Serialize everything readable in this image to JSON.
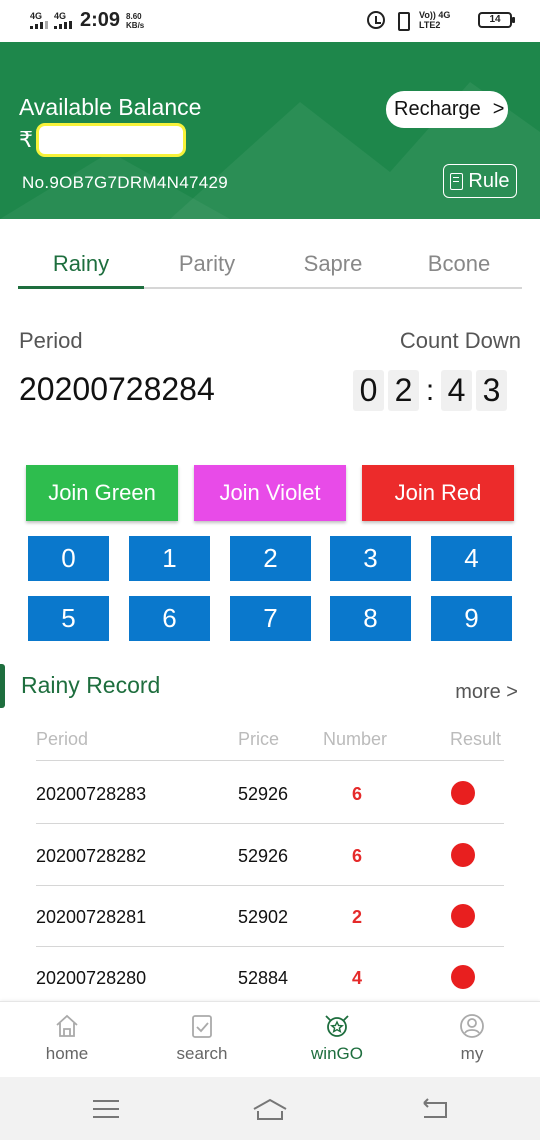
{
  "status_bar": {
    "signal1": "4G",
    "signal2": "4G",
    "time": "2:09",
    "speed_value": "8.60",
    "speed_unit": "KB/s",
    "network": "Vo)) 4G LTE2",
    "battery": "14"
  },
  "header": {
    "balance_label": "Available Balance",
    "currency_symbol": "₹",
    "account_number": "No.9OB7G7DRM4N47429",
    "recharge_label": "Recharge",
    "recharge_arrow": ">",
    "rule_label": "Rule"
  },
  "tabs": [
    {
      "label": "Rainy",
      "active": true
    },
    {
      "label": "Parity",
      "active": false
    },
    {
      "label": "Sapre",
      "active": false
    },
    {
      "label": "Bcone",
      "active": false
    }
  ],
  "period": {
    "label": "Period",
    "value": "20200728284"
  },
  "countdown": {
    "label": "Count Down",
    "digits": [
      "0",
      "2",
      "4",
      "3"
    ],
    "separator": ":"
  },
  "join_buttons": {
    "green": "Join Green",
    "violet": "Join Violet",
    "red": "Join Red"
  },
  "numbers": [
    "0",
    "1",
    "2",
    "3",
    "4",
    "5",
    "6",
    "7",
    "8",
    "9"
  ],
  "record": {
    "title": "Rainy Record",
    "more": "more >",
    "columns": [
      "Period",
      "Price",
      "Number",
      "Result"
    ],
    "rows": [
      {
        "period": "20200728283",
        "price": "52926",
        "number": "6",
        "result": "red"
      },
      {
        "period": "20200728282",
        "price": "52926",
        "number": "6",
        "result": "red"
      },
      {
        "period": "20200728281",
        "price": "52902",
        "number": "2",
        "result": "red"
      },
      {
        "period": "20200728280",
        "price": "52884",
        "number": "4",
        "result": "red"
      }
    ]
  },
  "bottom_nav": [
    {
      "label": "home",
      "icon": "home-icon",
      "active": false
    },
    {
      "label": "search",
      "icon": "clipboard-check-icon",
      "active": false
    },
    {
      "label": "winGO",
      "icon": "trophy-star-icon",
      "active": true
    },
    {
      "label": "my",
      "icon": "user-icon",
      "active": false
    }
  ],
  "colors": {
    "header_green": "#1e874b",
    "tab_active": "#1e6e3e",
    "join_green": "#2ebd4e",
    "join_violet": "#e84be8",
    "join_red": "#ec2b2b",
    "number_blue": "#0a78cc",
    "result_red": "#e81f1f"
  }
}
